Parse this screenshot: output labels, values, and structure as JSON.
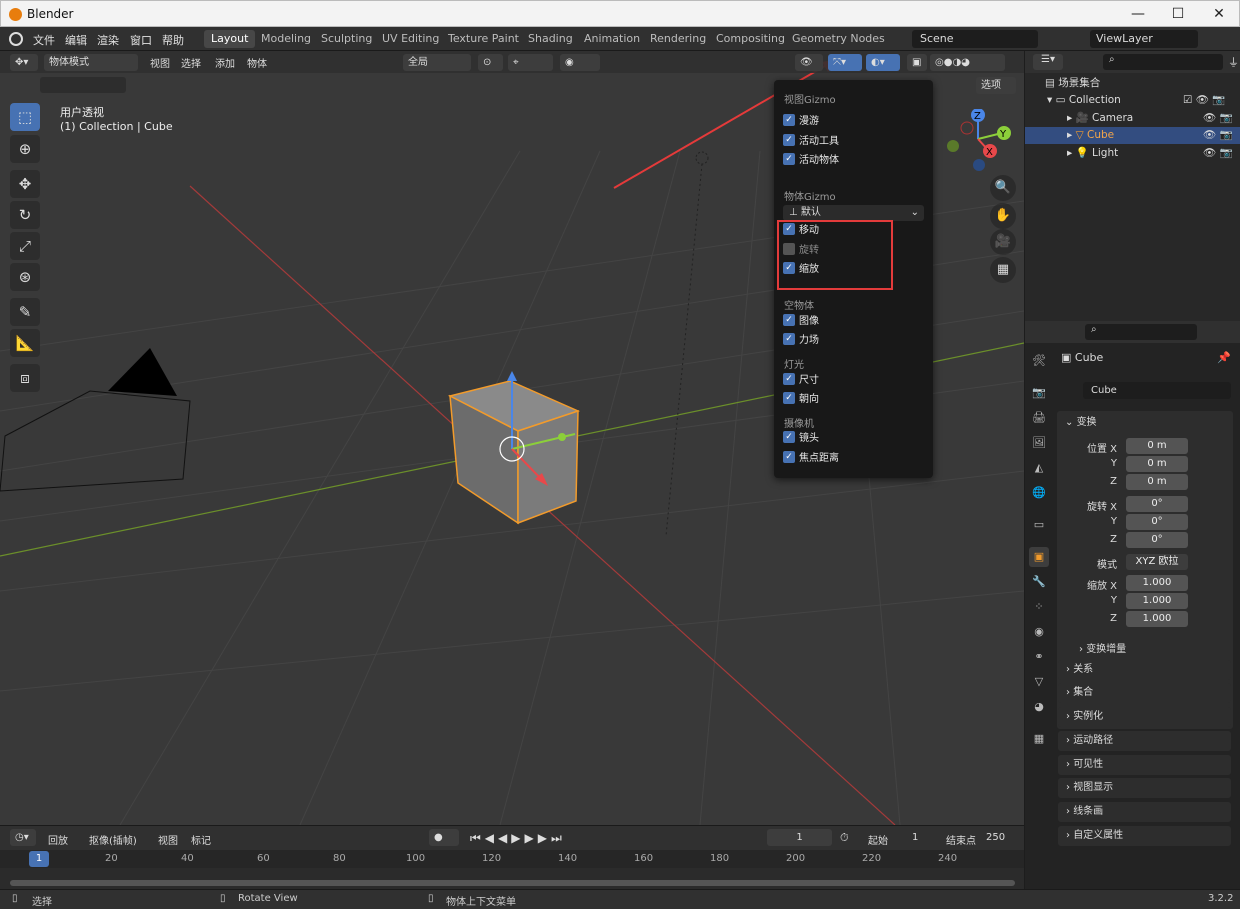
{
  "window": {
    "app_title": "Blender",
    "min": "—",
    "max": "☐",
    "close": "✕"
  },
  "menu": [
    "文件",
    "编辑",
    "渲染",
    "窗口",
    "帮助"
  ],
  "workspaces": [
    "Layout",
    "Modeling",
    "Sculpting",
    "UV Editing",
    "Texture Paint",
    "Shading",
    "Animation",
    "Rendering",
    "Compositing",
    "Geometry Nodes"
  ],
  "scene": "Scene",
  "view_layer": "ViewLayer",
  "viewport": {
    "mode": "物体模式",
    "menus": [
      "视图",
      "选择",
      "添加",
      "物体"
    ],
    "transform_orientation": "全局",
    "options": "选项",
    "view_name": "用户透视",
    "collection_info": "(1) Collection | Cube"
  },
  "gizmo_menu": {
    "viewport_gizmo_title": "视图Gizmo",
    "viewport_items": [
      {
        "label": "漫游",
        "checked": true
      },
      {
        "label": "活动工具",
        "checked": true
      },
      {
        "label": "活动物体",
        "checked": true
      }
    ],
    "object_gizmo_title": "物体Gizmo",
    "orientation": "默认",
    "object_items": [
      {
        "label": "移动",
        "checked": true
      },
      {
        "label": "旋转",
        "checked": false
      },
      {
        "label": "缩放",
        "checked": true
      }
    ],
    "empty_title": "空物体",
    "empty_items": [
      {
        "label": "图像",
        "checked": true
      },
      {
        "label": "力场",
        "checked": true
      }
    ],
    "light_title": "灯光",
    "light_items": [
      {
        "label": "尺寸",
        "checked": true
      },
      {
        "label": "朝向",
        "checked": true
      }
    ],
    "camera_title": "摄像机",
    "camera_items": [
      {
        "label": "镜头",
        "checked": true
      },
      {
        "label": "焦点距离",
        "checked": true
      }
    ]
  },
  "axes": {
    "x": "X",
    "y": "Y",
    "z": "Z"
  },
  "outliner": {
    "root": "场景集合",
    "collection": "Collection",
    "items": [
      "Camera",
      "Cube",
      "Light"
    ]
  },
  "properties": {
    "object_name": "Cube",
    "data_name": "Cube",
    "transform_title": "变换",
    "location_label": "位置 X",
    "y": "Y",
    "z": "Z",
    "location": [
      "0 m",
      "0 m",
      "0 m"
    ],
    "rotation_label": "旋转 X",
    "rotation": [
      "0°",
      "0°",
      "0°"
    ],
    "mode_label": "模式",
    "mode_value": "XYZ 欧拉",
    "scale_label": "缩放 X",
    "scale": [
      "1.000",
      "1.000",
      "1.000"
    ],
    "delta": "变换增量",
    "panels": [
      "关系",
      "集合",
      "实例化",
      "运动路径",
      "可见性",
      "视图显示",
      "线条画",
      "自定义属性"
    ]
  },
  "timeline": {
    "playback": "回放",
    "keying": "抠像(插帧)",
    "view": "视图",
    "marker": "标记",
    "current_frame": "1",
    "start_label": "起始",
    "start": "1",
    "end_label": "结束点",
    "end": "250",
    "ticks": [
      "1",
      "20",
      "40",
      "60",
      "80",
      "100",
      "120",
      "140",
      "160",
      "180",
      "200",
      "220",
      "240"
    ]
  },
  "status": {
    "select": "选择",
    "rotate": "Rotate View",
    "context": "物体上下文菜单",
    "version": "3.2.2"
  },
  "colors": {
    "accent": "#4772b3",
    "selected": "#f29b2b",
    "highlight_box": "#e33b3b"
  }
}
